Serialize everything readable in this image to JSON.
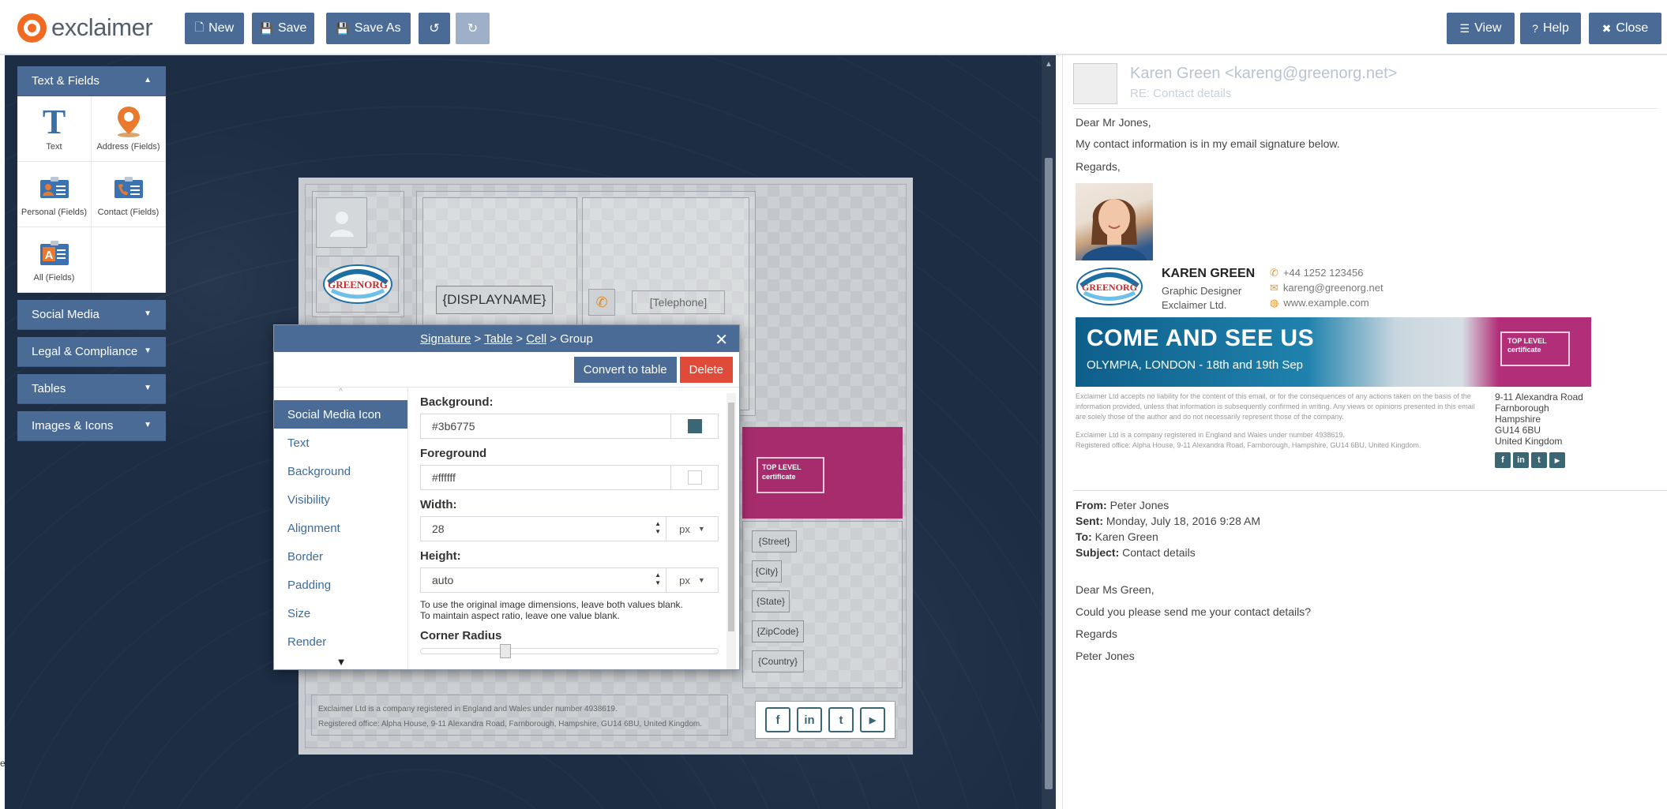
{
  "app": {
    "logo_text": "exclaimer"
  },
  "toolbar": {
    "new_label": "New",
    "save_label": "Save",
    "save_as_label": "Save As",
    "view_label": "View",
    "help_label": "Help",
    "close_label": "Close"
  },
  "sidebar": {
    "text_fields": {
      "header": "Text & Fields",
      "tools": [
        {
          "label": "Text",
          "icon": "text-icon"
        },
        {
          "label": "Address (Fields)",
          "icon": "map-pin-icon"
        },
        {
          "label": "Personal (Fields)",
          "icon": "person-card-icon"
        },
        {
          "label": "Contact (Fields)",
          "icon": "phone-card-icon"
        },
        {
          "label": "All (Fields)",
          "icon": "all-fields-icon"
        }
      ]
    },
    "sections": [
      "Social Media",
      "Legal & Compliance",
      "Tables",
      "Images & Icons"
    ]
  },
  "canvas": {
    "display_name": "{DISPLAYNAME}",
    "telephone": "[Telephone]",
    "logo_text": "GREENORG",
    "banner_cert": "TOP LEVEL certificate",
    "address_fields": [
      "{Street}",
      "{City}",
      "{State}",
      "{ZipCode}",
      "{Country}"
    ],
    "social": [
      "f",
      "in",
      "t",
      "▶"
    ],
    "disclaimer_line1": "Exclaimer Ltd is a company registered in England and Wales under number 4938619.",
    "disclaimer_line2": "Registered office: Alpha House, 9-11 Alexandra Road, Farnborough, Hampshire, GU14 6BU, United Kingdom."
  },
  "dialog": {
    "breadcrumb": [
      "Signature",
      "Table",
      "Cell",
      "Group"
    ],
    "sep": ">",
    "convert_label": "Convert to table",
    "delete_label": "Delete",
    "nav": [
      "Social Media Icon",
      "Text",
      "Background",
      "Visibility",
      "Alignment",
      "Border",
      "Padding",
      "Size",
      "Render"
    ],
    "active_nav": "Social Media Icon",
    "background_label": "Background:",
    "background_value": "#3b6775",
    "background_color": "#3b6775",
    "foreground_label": "Foreground",
    "foreground_value": "#ffffff",
    "foreground_color": "#ffffff",
    "width_label": "Width:",
    "width_value": "28",
    "height_label": "Height:",
    "height_value": "auto",
    "unit": "px",
    "hint1": "To use the original image dimensions, leave both values blank.",
    "hint2": "To maintain aspect ratio, leave one value blank.",
    "corner_label": "Corner Radius"
  },
  "preview": {
    "from_header": "Karen Green <kareng@greenorg.net>",
    "subject_header": "RE: Contact details",
    "greeting": "Dear Mr Jones,",
    "line1": "My contact information is in my email signature below.",
    "regards": "Regards,",
    "sig_name": "KAREN GREEN",
    "sig_title": "Graphic Designer",
    "sig_company": "Exclaimer Ltd.",
    "sig_phone": "+44 1252 123456",
    "sig_email": "kareng@greenorg.net",
    "sig_web": "www.example.com",
    "banner_headline": "COME AND SEE US",
    "banner_sub": "OLYMPIA, LONDON - 18th and 19th Sep",
    "banner_cert": "TOP LEVEL certificate",
    "disclaimer": "Exclaimer Ltd accepts no liability for the content of this email, or for the consequences of any actions taken on the basis of the information provided, unless that information is subsequently confirmed in writing. Any views or opinions presented in this email are solely those of the author and do not necessarily represent those of the company.",
    "disclaimer2": "Exclaimer Ltd is a company registered in England and Wales under number 4938619.",
    "disclaimer3": "Registered office: Alpha House, 9-11 Alexandra Road, Farnborough, Hampshire, GU14 6BU, United Kingdom.",
    "address": [
      "9-11 Alexandra Road",
      "Farnborough",
      "Hampshire",
      "GU14 6BU",
      "United Kingdom"
    ],
    "meta_from_label": "From:",
    "meta_from": "Peter Jones",
    "meta_sent_label": "Sent:",
    "meta_sent": "Monday, July 18, 2016 9:28 AM",
    "meta_to_label": "To:",
    "meta_to": "Karen Green",
    "meta_subject_label": "Subject:",
    "meta_subject": "Contact details",
    "reply_greeting": "Dear Ms Green,",
    "reply_line": "Could you please send me your contact details?",
    "reply_regards": "Regards",
    "reply_name": "Peter Jones"
  }
}
